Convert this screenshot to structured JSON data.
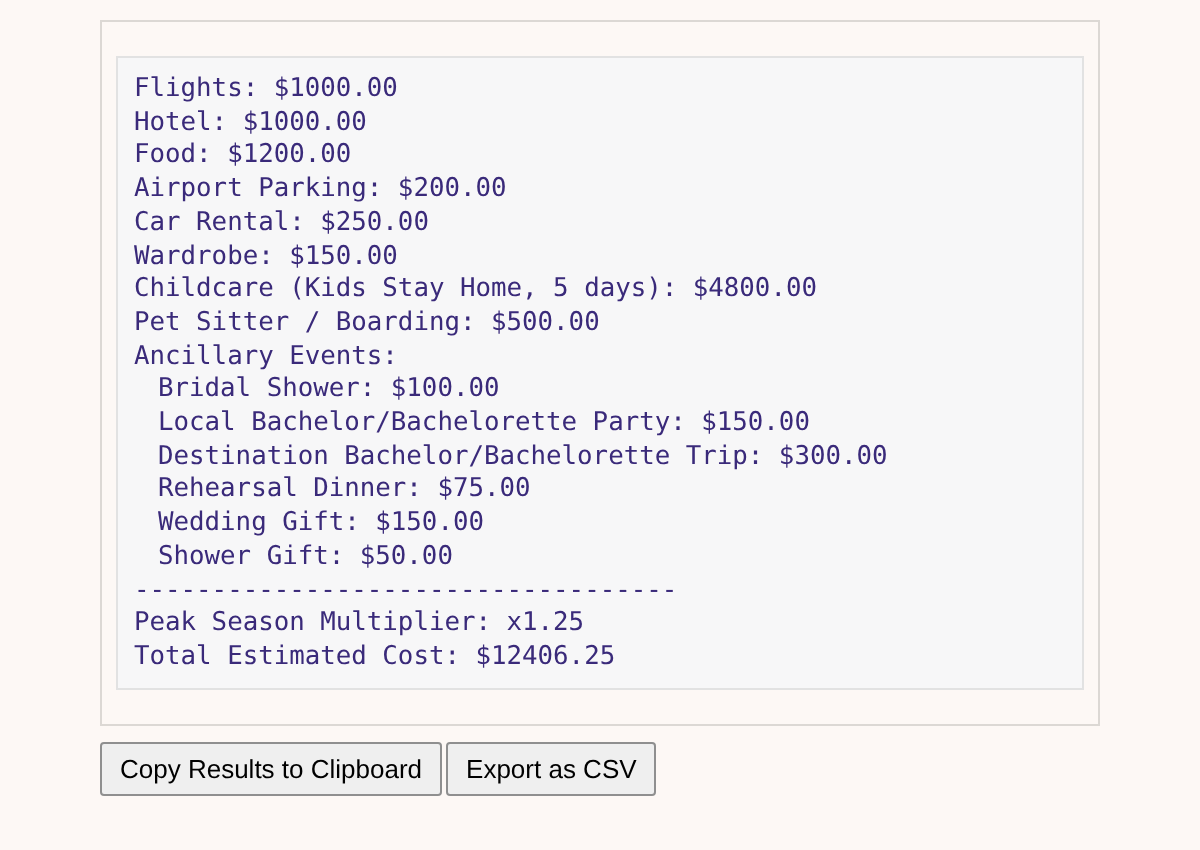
{
  "results": {
    "lines": [
      {
        "text": "Flights: $1000.00"
      },
      {
        "text": "Hotel: $1000.00"
      },
      {
        "text": "Food: $1200.00"
      },
      {
        "text": "Airport Parking: $200.00"
      },
      {
        "text": "Car Rental: $250.00"
      },
      {
        "text": "Wardrobe: $150.00"
      },
      {
        "text": "Childcare (Kids Stay Home, 5 days): $4800.00"
      },
      {
        "text": "Pet Sitter / Boarding: $500.00"
      },
      {
        "text": "Ancillary Events:",
        "children": [
          {
            "text": "Bridal Shower: $100.00"
          },
          {
            "text": "Local Bachelor/Bachelorette Party: $150.00"
          },
          {
            "text": "Destination Bachelor/Bachelorette Trip: $300.00"
          },
          {
            "text": "Rehearsal Dinner: $75.00"
          },
          {
            "text": "Wedding Gift: $150.00"
          },
          {
            "text": "Shower Gift: $50.00"
          }
        ]
      },
      {
        "text": "-----------------------------------"
      },
      {
        "text": "Peak Season Multiplier: x1.25"
      },
      {
        "text": "Total Estimated Cost: $12406.25"
      }
    ]
  },
  "buttons": [
    "Copy Results to Clipboard",
    "Export as CSV"
  ]
}
